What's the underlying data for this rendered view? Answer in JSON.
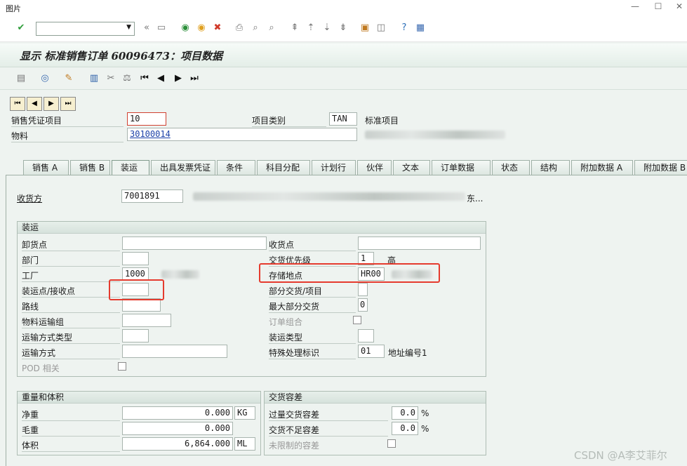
{
  "window": {
    "title": "图片",
    "min": "—",
    "max": "☐",
    "close": "✕"
  },
  "title": "显示 标准销售订单 60096473：项目数据",
  "header": {
    "item_label": "销售凭证项目",
    "item_value": "10",
    "category_label": "项目类别",
    "category_value": "TAN",
    "category_desc": "标准项目",
    "material_label": "物料",
    "material_value": "30100014"
  },
  "tabs": [
    "销售 A",
    "销售 B",
    "装运",
    "出具发票凭证",
    "条件",
    "科目分配",
    "计划行",
    "伙伴",
    "文本",
    "订单数据",
    "状态",
    "结构",
    "附加数据 A",
    "附加数据 B"
  ],
  "active_tab": "装运",
  "ship_to": {
    "label": "收货方",
    "value": "7001891",
    "suffix": "东..."
  },
  "shipping_group": {
    "title": "装运",
    "unloading_point": {
      "label": "卸货点",
      "value": ""
    },
    "receiving_point": {
      "label": "收货点",
      "value": ""
    },
    "department": {
      "label": "部门",
      "value": ""
    },
    "delivery_priority": {
      "label": "交货优先级",
      "value": "1",
      "desc": "高"
    },
    "plant": {
      "label": "工厂",
      "value": "1000"
    },
    "storage_location": {
      "label": "存储地点",
      "value": "HR00"
    },
    "shipping_point": {
      "label": "装运点/接收点",
      "value": ""
    },
    "partial_delivery": {
      "label": "部分交货/项目",
      "value": ""
    },
    "route": {
      "label": "路线",
      "value": ""
    },
    "max_partial": {
      "label": "最大部分交货",
      "value": "0"
    },
    "material_freight_group": {
      "label": "物料运输组",
      "value": ""
    },
    "order_combination": {
      "label": "订单组合"
    },
    "transport_mode_type": {
      "label": "运输方式类型",
      "value": ""
    },
    "shipping_type": {
      "label": "装运类型",
      "value": ""
    },
    "transport_mode": {
      "label": "运输方式",
      "value": ""
    },
    "special_processing": {
      "label": "特殊处理标识",
      "value": "01",
      "desc": "地址编号1"
    },
    "pod": {
      "label": "POD 相关"
    }
  },
  "weight_group": {
    "title": "重量和体积",
    "net": {
      "label": "净重",
      "value": "0.000",
      "unit": "KG"
    },
    "gross": {
      "label": "毛重",
      "value": "0.000"
    },
    "volume": {
      "label": "体积",
      "value": "6,864.000",
      "unit": "ML"
    }
  },
  "tolerance_group": {
    "title": "交货容差",
    "over": {
      "label": "过量交货容差",
      "value": "0.0",
      "unit": "%"
    },
    "under": {
      "label": "交货不足容差",
      "value": "0.0",
      "unit": "%"
    },
    "unlimited": {
      "label": "未限制的容差"
    }
  },
  "watermark": "CSDN @A李艾菲尔",
  "colors": {
    "highlight": "#e53b2e",
    "nav_button": "#f6efd0",
    "panel": "#eef3f0"
  }
}
